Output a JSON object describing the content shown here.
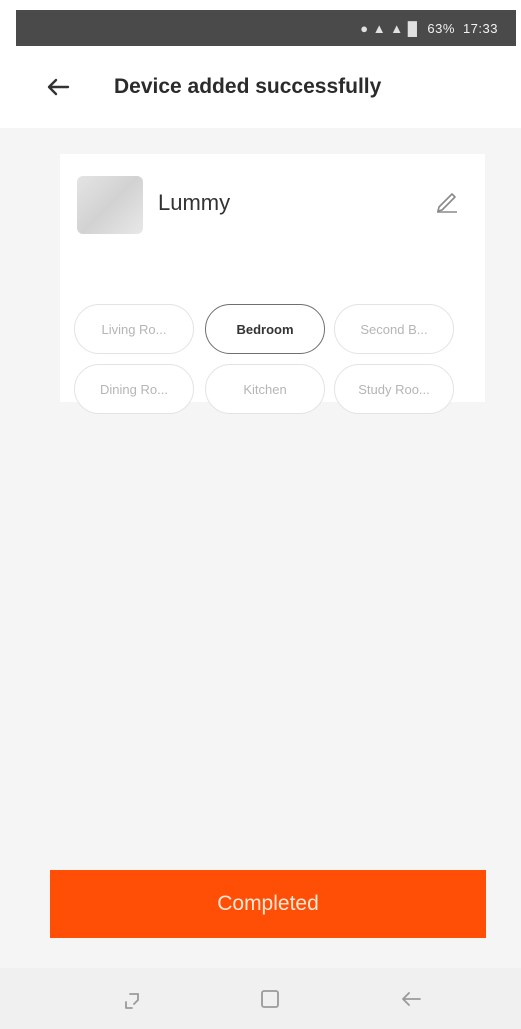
{
  "status_bar": {
    "text": "17:33",
    "battery": "63%"
  },
  "header": {
    "title": "Device added successfully"
  },
  "device": {
    "name": "Lummy"
  },
  "rooms": [
    {
      "label": "Living Ro..."
    },
    {
      "label": "Bedroom"
    },
    {
      "label": "Second B..."
    },
    {
      "label": "Dining Ro..."
    },
    {
      "label": "Kitchen"
    },
    {
      "label": "Study Roo..."
    }
  ],
  "selected_room": "Bedroom",
  "actions": {
    "complete_label": "Completed"
  },
  "colors": {
    "accent": "#ff4e06",
    "background": "#f5f5f6",
    "status_bar": "#4a4a4a"
  },
  "icons": {
    "back": "arrow-left-icon",
    "edit": "pencil-icon",
    "nav_recent": "recent-apps-icon",
    "nav_home": "home-square-icon",
    "nav_back": "nav-back-icon"
  }
}
